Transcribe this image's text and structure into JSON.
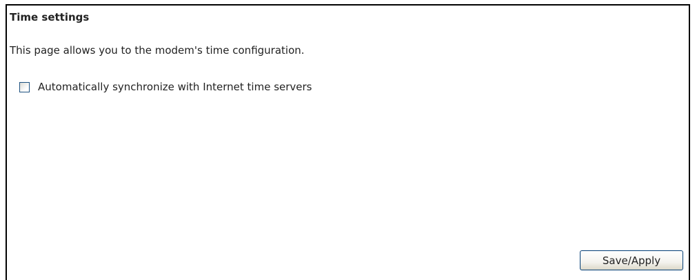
{
  "page": {
    "title": "Time settings",
    "description": "This page allows you to the modem's time configuration."
  },
  "sync": {
    "label": "Automatically synchronize with Internet time servers",
    "checked": false
  },
  "actions": {
    "save_label": "Save/Apply"
  },
  "colors": {
    "border": "#000000",
    "button_border": "#003c74",
    "checkbox_border": "#1c5180"
  }
}
